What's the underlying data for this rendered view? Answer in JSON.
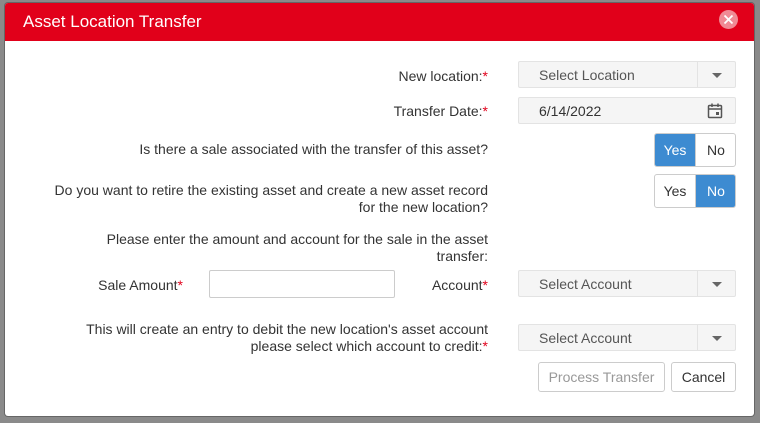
{
  "dialog": {
    "title": "Asset Location Transfer"
  },
  "form": {
    "new_location_label": "New location:",
    "new_location_placeholder": "Select Location",
    "transfer_date_label": "Transfer Date:",
    "transfer_date_value": "6/14/2022",
    "sale_question": "Is there a sale associated with the transfer of this asset?",
    "sale_toggle": {
      "yes": "Yes",
      "no": "No",
      "selected": "Yes"
    },
    "retire_question_line1": "Do you want to retire the existing asset and create a new asset record",
    "retire_question_line2": "for the new location?",
    "retire_toggle": {
      "yes": "Yes",
      "no": "No",
      "selected": "No"
    },
    "sale_info_line1": "Please enter the amount and account for the sale in the asset",
    "sale_info_line2": "transfer:",
    "sale_amount_label": "Sale Amount",
    "sale_amount_value": "",
    "account_label": "Account",
    "account_placeholder": "Select Account",
    "credit_line1": "This will create an entry to debit the new location's asset account",
    "credit_line2": "please select which account to credit:",
    "credit_account_placeholder": "Select Account",
    "required_marker": "*"
  },
  "footer": {
    "process_label": "Process Transfer",
    "cancel_label": "Cancel"
  },
  "colors": {
    "header": "#e1001a",
    "toggle_active": "#3d8bd1",
    "required": "#e1001a"
  }
}
